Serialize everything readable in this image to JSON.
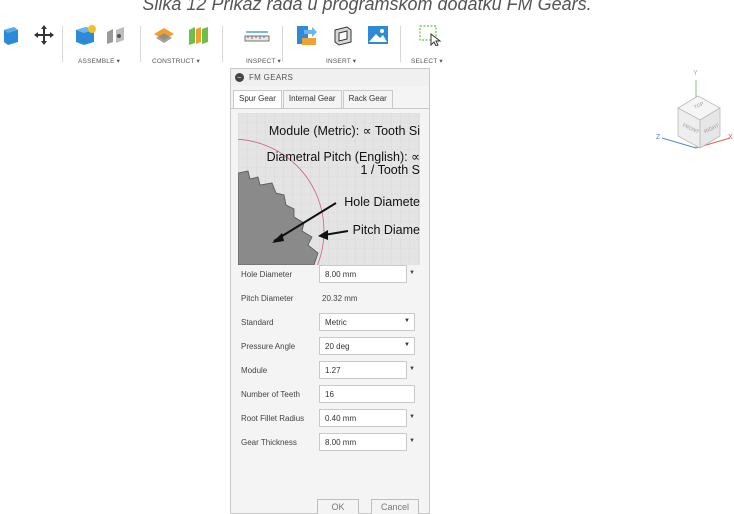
{
  "caption": "Slika 12 Prikaz rada u programskom dodatku FM Gears.",
  "toolbar": {
    "assemble_label": "ASSEMBLE ▾",
    "construct_label": "CONSTRUCT ▾",
    "inspect_label": "INSPECT ▾",
    "insert_label": "INSERT ▾",
    "select_label": "SELECT ▾"
  },
  "panel": {
    "title": "FM GEARS",
    "tabs": [
      "Spur Gear",
      "Internal Gear",
      "Rack Gear"
    ],
    "active_tab": "Spur Gear",
    "diagram_text": {
      "line1": "Module (Metric): ∝ Tooth Si",
      "line2": "Diametral Pitch (English): ∝",
      "line3": "1 / Tooth S",
      "hole_label": "Hole Diamete",
      "pitch_label": "Pitch Diame"
    },
    "fields": {
      "hole_diameter": {
        "label": "Hole Diameter",
        "value": "8.00 mm"
      },
      "pitch_diameter": {
        "label": "Pitch Diameter",
        "value": "20.32 mm"
      },
      "standard": {
        "label": "Standard",
        "value": "Metric"
      },
      "pressure_angle": {
        "label": "Pressure Angle",
        "value": "20 deg"
      },
      "module": {
        "label": "Module",
        "value": "1.27"
      },
      "number_of_teeth": {
        "label": "Number of Teeth",
        "value": "16"
      },
      "root_fillet_radius": {
        "label": "Root Fillet Radius",
        "value": "0.40 mm"
      },
      "gear_thickness": {
        "label": "Gear Thickness",
        "value": "8.00 mm"
      }
    },
    "ok_label": "OK",
    "cancel_label": "Cancel"
  },
  "viewcube": {
    "top": "TOP",
    "front": "FRONT",
    "right": "RIGHT",
    "axis_x": "X",
    "axis_y": "Y",
    "axis_z": "Z"
  },
  "colors": {
    "panel_bg": "#f4f4f4",
    "gear_fill": "#8a8a8a",
    "pitch_circle": "#d06080",
    "axis_x": "#e06060",
    "axis_y": "#7cc870",
    "axis_z": "#6080d0"
  }
}
